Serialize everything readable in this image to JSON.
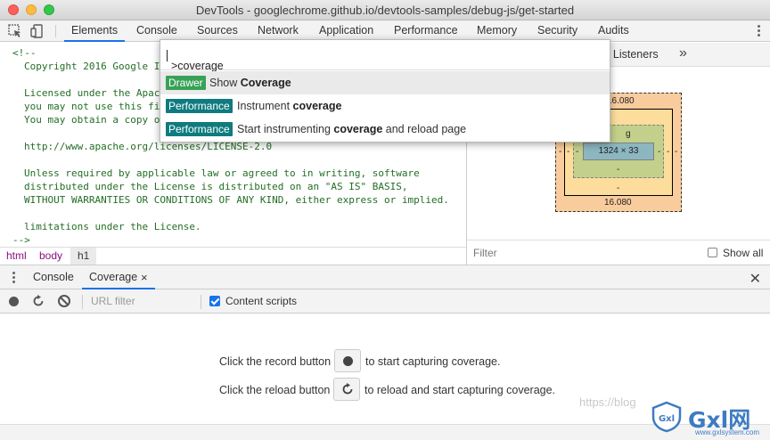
{
  "window": {
    "title": "DevTools - googlechrome.github.io/devtools-samples/debug-js/get-started"
  },
  "main_tabs": [
    "Elements",
    "Console",
    "Sources",
    "Network",
    "Application",
    "Performance",
    "Memory",
    "Security",
    "Audits"
  ],
  "source_lines": [
    "<!--",
    "Copyright 2016 Google I",
    "",
    "Licensed under the Apac",
    "you may not use this fi",
    "You may obtain a copy o",
    "",
    "http://www.apache.org/licenses/LICENSE-2.0",
    "",
    "Unless required by applicable law or agreed to in writing, software",
    "distributed under the License is distributed on an \"AS IS\" BASIS,",
    "WITHOUT WARRANTIES OR CONDITIONS OF ANY KIND, either express or implied.",
    "",
    "limitations under the License.",
    "-->"
  ],
  "breadcrumbs": [
    "html",
    "body",
    "h1"
  ],
  "sidebar": {
    "tab_label": "nt Listeners",
    "more": "»",
    "box_model": {
      "margin_top": "16.080",
      "margin_bottom": "16.080",
      "border_bottom": "-",
      "padding_label": "g",
      "padding_bottom": "-",
      "content": "1324 × 33",
      "left_dash": "-",
      "right_dash": "-",
      "inner_left": "-",
      "inner_right": "-",
      "p_left": "-",
      "p_right": "-"
    },
    "filter_placeholder": "Filter",
    "show_all": "Show all"
  },
  "drawer": {
    "tabs": [
      "Console",
      "Coverage"
    ],
    "close_tab": "×",
    "close_drawer": "✕"
  },
  "coverage": {
    "url_filter_placeholder": "URL filter",
    "content_scripts": "Content scripts",
    "record_prefix": "Click the record button",
    "record_suffix": "to start capturing coverage.",
    "reload_prefix": "Click the reload button",
    "reload_suffix": "to reload and start capturing coverage."
  },
  "command_menu": {
    "input": ">coverage",
    "items": [
      {
        "badge": "Drawer",
        "badge_color": "#38a157",
        "pre": "Show ",
        "bold": "Coverage",
        "post": ""
      },
      {
        "badge": "Performance",
        "badge_color": "#0f7b7f",
        "pre": "Instrument ",
        "bold": "coverage",
        "post": ""
      },
      {
        "badge": "Performance",
        "badge_color": "#0f7b7f",
        "pre": "Start instrumenting ",
        "bold": "coverage",
        "post": " and reload page"
      }
    ]
  },
  "watermark": {
    "text": "https://blog",
    "brand": "Gxl网",
    "url": "www.gxlsystem.com"
  }
}
